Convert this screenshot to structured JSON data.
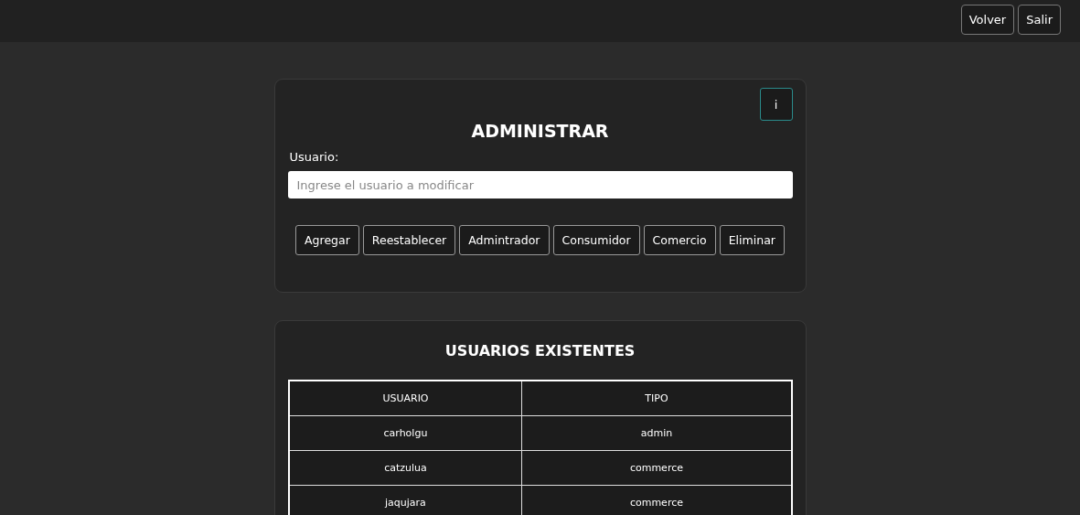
{
  "top_bar": {
    "buttons": [
      "Volver",
      "Salir"
    ]
  },
  "admin_card": {
    "info_button": "i",
    "title": "ADMINISTRAR",
    "field_label": "Usuario:",
    "field": {
      "placeholder": "Ingrese el usuario a modificar"
    },
    "buttons": [
      "Agregar",
      "Reestablecer",
      "Admintrador",
      "Consumidor",
      "Comercio",
      "Eliminar"
    ]
  },
  "users_card": {
    "title": "USUARIOS EXISTENTES",
    "table": {
      "columns": [
        "USUARIO",
        "TIPO"
      ],
      "rows": [
        [
          "carholgu",
          "admin"
        ],
        [
          "catzulua",
          "commerce"
        ],
        [
          "jaqujara",
          "commerce"
        ]
      ]
    }
  }
}
